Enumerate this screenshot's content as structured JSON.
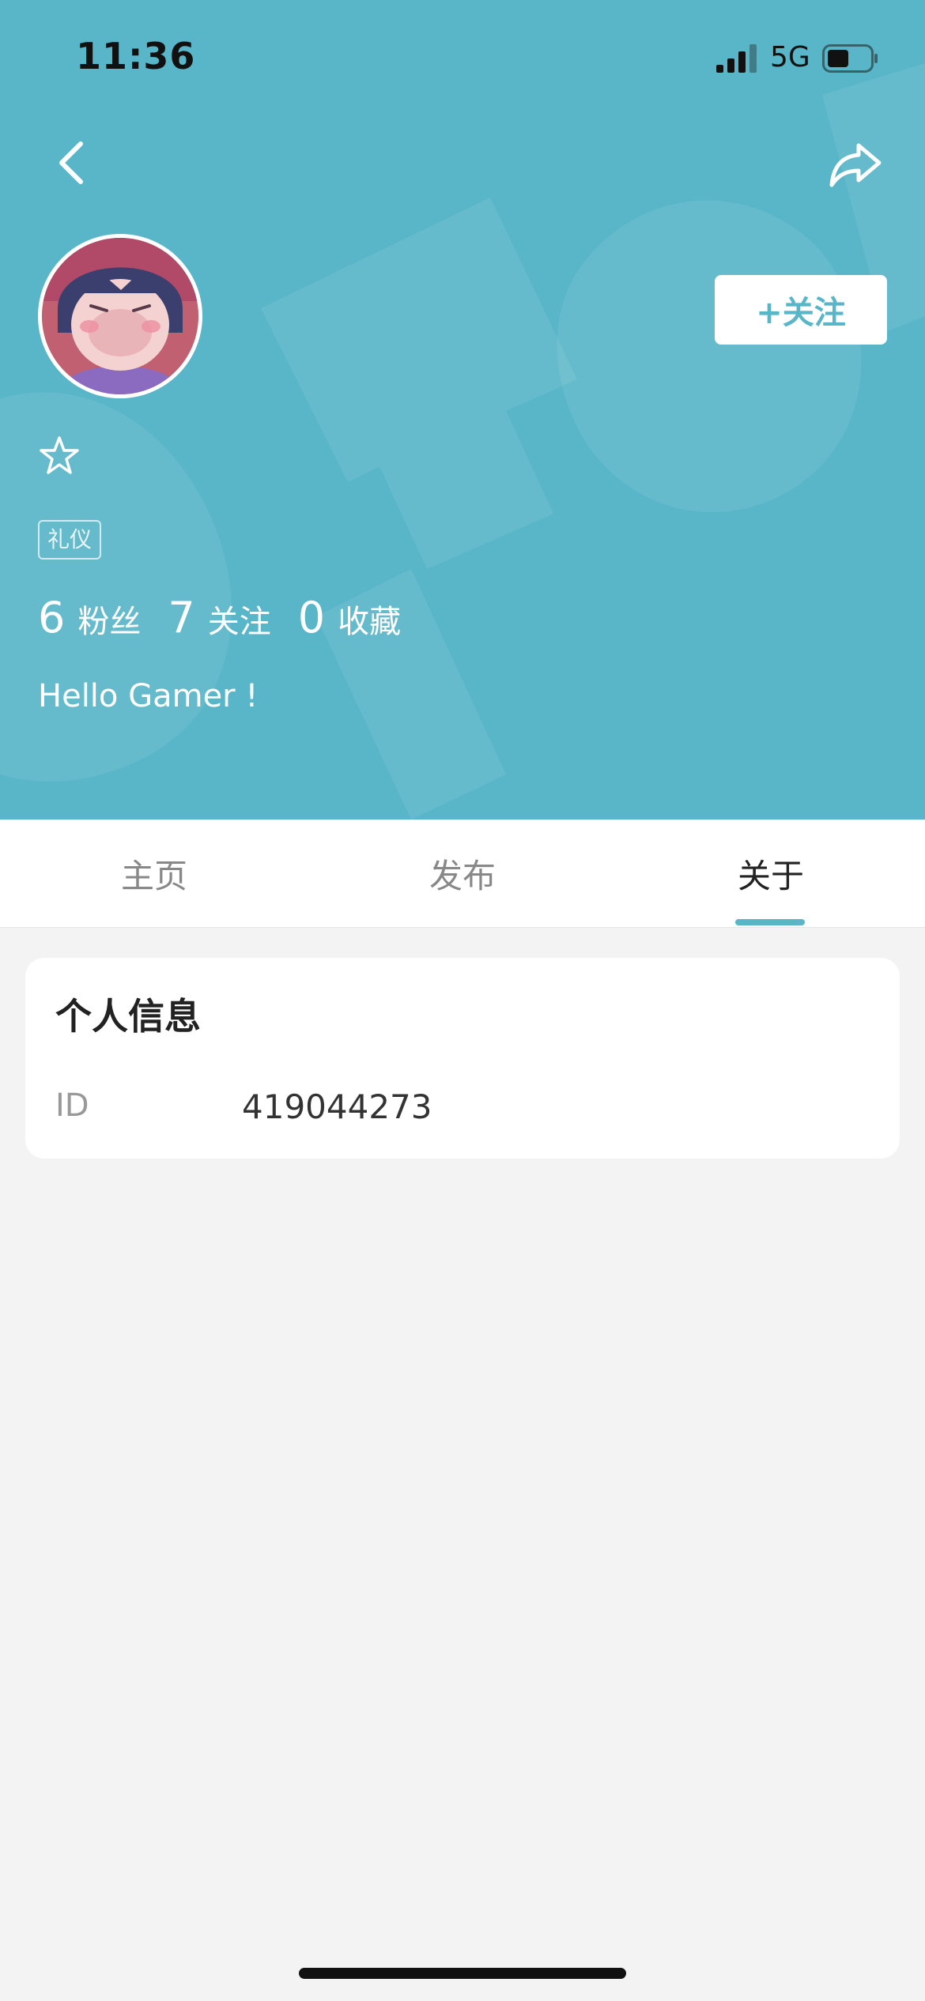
{
  "status_bar": {
    "time": "11:36",
    "network": "5G"
  },
  "header": {
    "back_icon": "chevron-left-icon",
    "share_icon": "share-arrow-icon",
    "follow_label": "+关注",
    "tag_label": "礼仪",
    "bio": "Hello Gamer !",
    "background_color": "#58b6c8"
  },
  "stats": [
    {
      "value": "6",
      "label": "粉丝"
    },
    {
      "value": "7",
      "label": "关注"
    },
    {
      "value": "0",
      "label": "收藏"
    }
  ],
  "tabs": [
    {
      "label": "主页",
      "active": false
    },
    {
      "label": "发布",
      "active": false
    },
    {
      "label": "关于",
      "active": true
    }
  ],
  "info_card": {
    "title": "个人信息",
    "rows": [
      {
        "label": "ID",
        "value": "419044273"
      }
    ]
  },
  "colors": {
    "accent": "#58b6c8",
    "page_bg": "#f3f3f3"
  }
}
